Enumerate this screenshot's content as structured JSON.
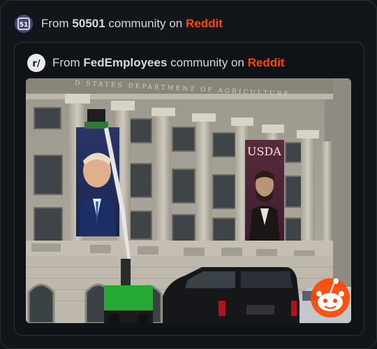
{
  "outer": {
    "prefix": "From",
    "community": "50501",
    "middle": "community on",
    "platform": "Reddit"
  },
  "inner": {
    "prefix": "From",
    "community": "FedEmployees",
    "middle": "community on",
    "platform": "Reddit"
  },
  "photo": {
    "banner_right_text": "USDA",
    "building_inscription": "D STATES DEPARTMENT OF AGRICULTURE"
  },
  "colors": {
    "background": "#121519",
    "reddit_orange": "#ff4500",
    "text": "#d7dadc"
  },
  "icons": {
    "outer_badge": "community-badge-icon",
    "inner_badge": "reddit-r-slash-icon",
    "watermark": "reddit-snoo-icon"
  }
}
